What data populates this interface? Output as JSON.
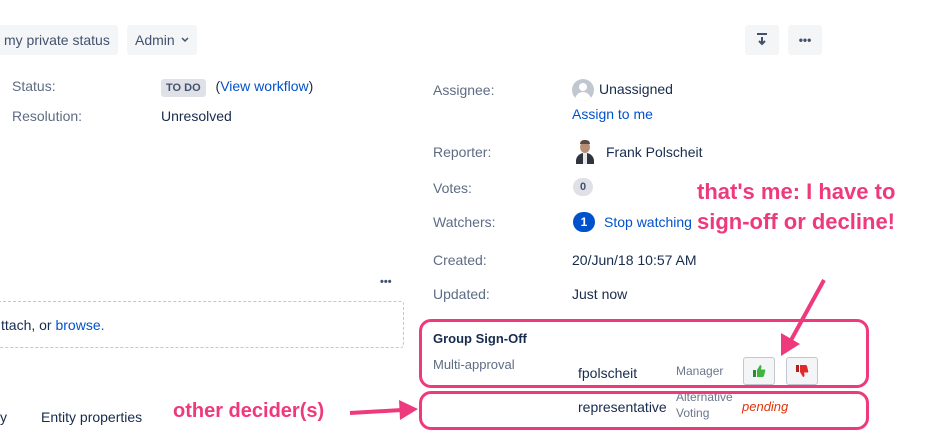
{
  "toolbar": {
    "private_status_label": "my private status",
    "admin_label": "Admin",
    "export_icon": "download-icon",
    "more_icon": "ellipsis-icon"
  },
  "details": {
    "status_label": "Status:",
    "status_value": "TO DO",
    "view_workflow_prefix": "(",
    "view_workflow": "View workflow",
    "view_workflow_suffix": ")",
    "resolution_label": "Resolution:",
    "resolution_value": "Unresolved"
  },
  "attachments": {
    "more_label": "•••",
    "drop_text_prefix": "ttach, or ",
    "browse_link": "browse."
  },
  "bottom_tabs": {
    "cut_tab": "y",
    "entity_properties": "Entity properties"
  },
  "people": {
    "assignee_label": "Assignee:",
    "assignee_value": "Unassigned",
    "assign_to_me": "Assign to me",
    "reporter_label": "Reporter:",
    "reporter_value": "Frank Polscheit",
    "votes_label": "Votes:",
    "votes_count": "0",
    "watchers_label": "Watchers:",
    "watchers_count": "1",
    "stop_watching": "Stop watching"
  },
  "dates": {
    "created_label": "Created:",
    "created_value": "20/Jun/18 10:57 AM",
    "updated_label": "Updated:",
    "updated_value": "Just now"
  },
  "signoff": {
    "title": "Group Sign-Off",
    "subtitle": "Multi-approval",
    "row1": {
      "user": "fpolscheit",
      "role": "Manager"
    },
    "row2": {
      "user": "representative",
      "role_line1": "Alternative",
      "role_line2": "Voting",
      "status": "pending"
    }
  },
  "annotations": {
    "me_line1": "that's me: I have to",
    "me_line2": "sign-off or decline!",
    "other": "other decider(s)",
    "color": "#ee3a7d"
  }
}
